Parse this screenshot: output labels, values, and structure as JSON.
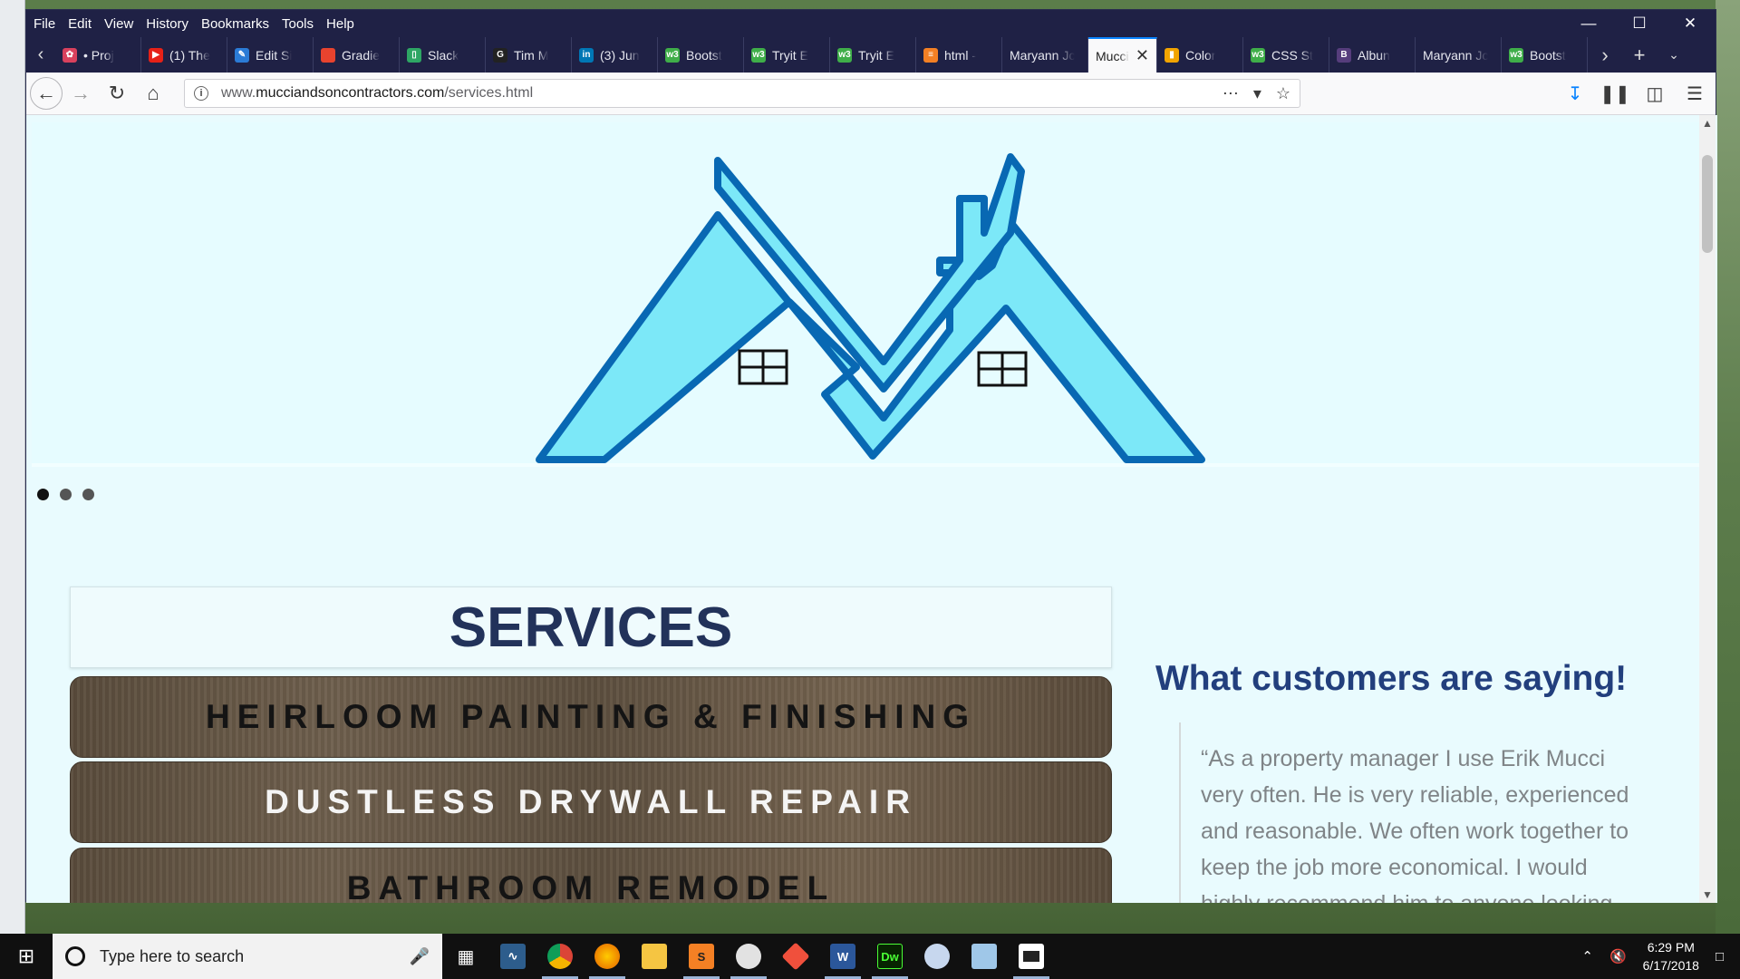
{
  "menu": [
    "File",
    "Edit",
    "View",
    "History",
    "Bookmarks",
    "Tools",
    "Help"
  ],
  "tabs": [
    {
      "label": "• Proj",
      "fav": "#d9415d",
      "glyph": "✿"
    },
    {
      "label": "(1) The",
      "fav": "#e62117",
      "glyph": "▶"
    },
    {
      "label": "Edit Si",
      "fav": "#2b7bd6",
      "glyph": "✎"
    },
    {
      "label": "Gradie",
      "fav": "#e8432e",
      "glyph": ""
    },
    {
      "label": "Slack",
      "fav": "#2ea664",
      "glyph": "▯"
    },
    {
      "label": "Tim M",
      "fav": "#222222",
      "glyph": "G"
    },
    {
      "label": "(3) Jun",
      "fav": "#0077b5",
      "glyph": "in"
    },
    {
      "label": "Bootst",
      "fav": "#3fae49",
      "glyph": "w3"
    },
    {
      "label": "Tryit E",
      "fav": "#3fae49",
      "glyph": "w3"
    },
    {
      "label": "Tryit E",
      "fav": "#3fae49",
      "glyph": "w3"
    },
    {
      "label": "html -",
      "fav": "#f48024",
      "glyph": "≡"
    },
    {
      "label": "Maryann Jc",
      "fav": "",
      "glyph": ""
    },
    {
      "label": "Mucci",
      "fav": "",
      "glyph": "",
      "active": true
    },
    {
      "label": "Color",
      "fav": "#f2a400",
      "glyph": "▮"
    },
    {
      "label": "CSS St",
      "fav": "#3fae49",
      "glyph": "w3"
    },
    {
      "label": "Albun",
      "fav": "#563d7c",
      "glyph": "B"
    },
    {
      "label": "Maryann Jc",
      "fav": "",
      "glyph": ""
    },
    {
      "label": "Bootst",
      "fav": "#3fae49",
      "glyph": "w3"
    }
  ],
  "url": {
    "prefix": "www.",
    "host": "mucciandsoncontractors.com",
    "path": "/services.html"
  },
  "carousel": {
    "slides": 3,
    "active": 0
  },
  "services": {
    "title": "SERVICES",
    "items": [
      "HEIRLOOM PAINTING & FINISHING",
      "DUSTLESS DRYWALL REPAIR",
      "BATHROOM REMODEL"
    ]
  },
  "reviews": {
    "title": "What customers are saying!",
    "quote": "“As a property manager I use Erik Mucci very often. He is very reliable, experienced and reasonable. We often work together to keep the job more economical. I would highly recommend him to anyone looking"
  },
  "taskbar": {
    "search_placeholder": "Type here to search",
    "time": "6:29 PM",
    "date": "6/17/2018"
  },
  "colors": {
    "accent": "#0a84ff",
    "titlebar": "#1f2145",
    "page_bg": "#e9fbfe",
    "roof_fill": "#7ce8f8",
    "roof_stroke": "#0868b3",
    "heading": "#22325a"
  }
}
